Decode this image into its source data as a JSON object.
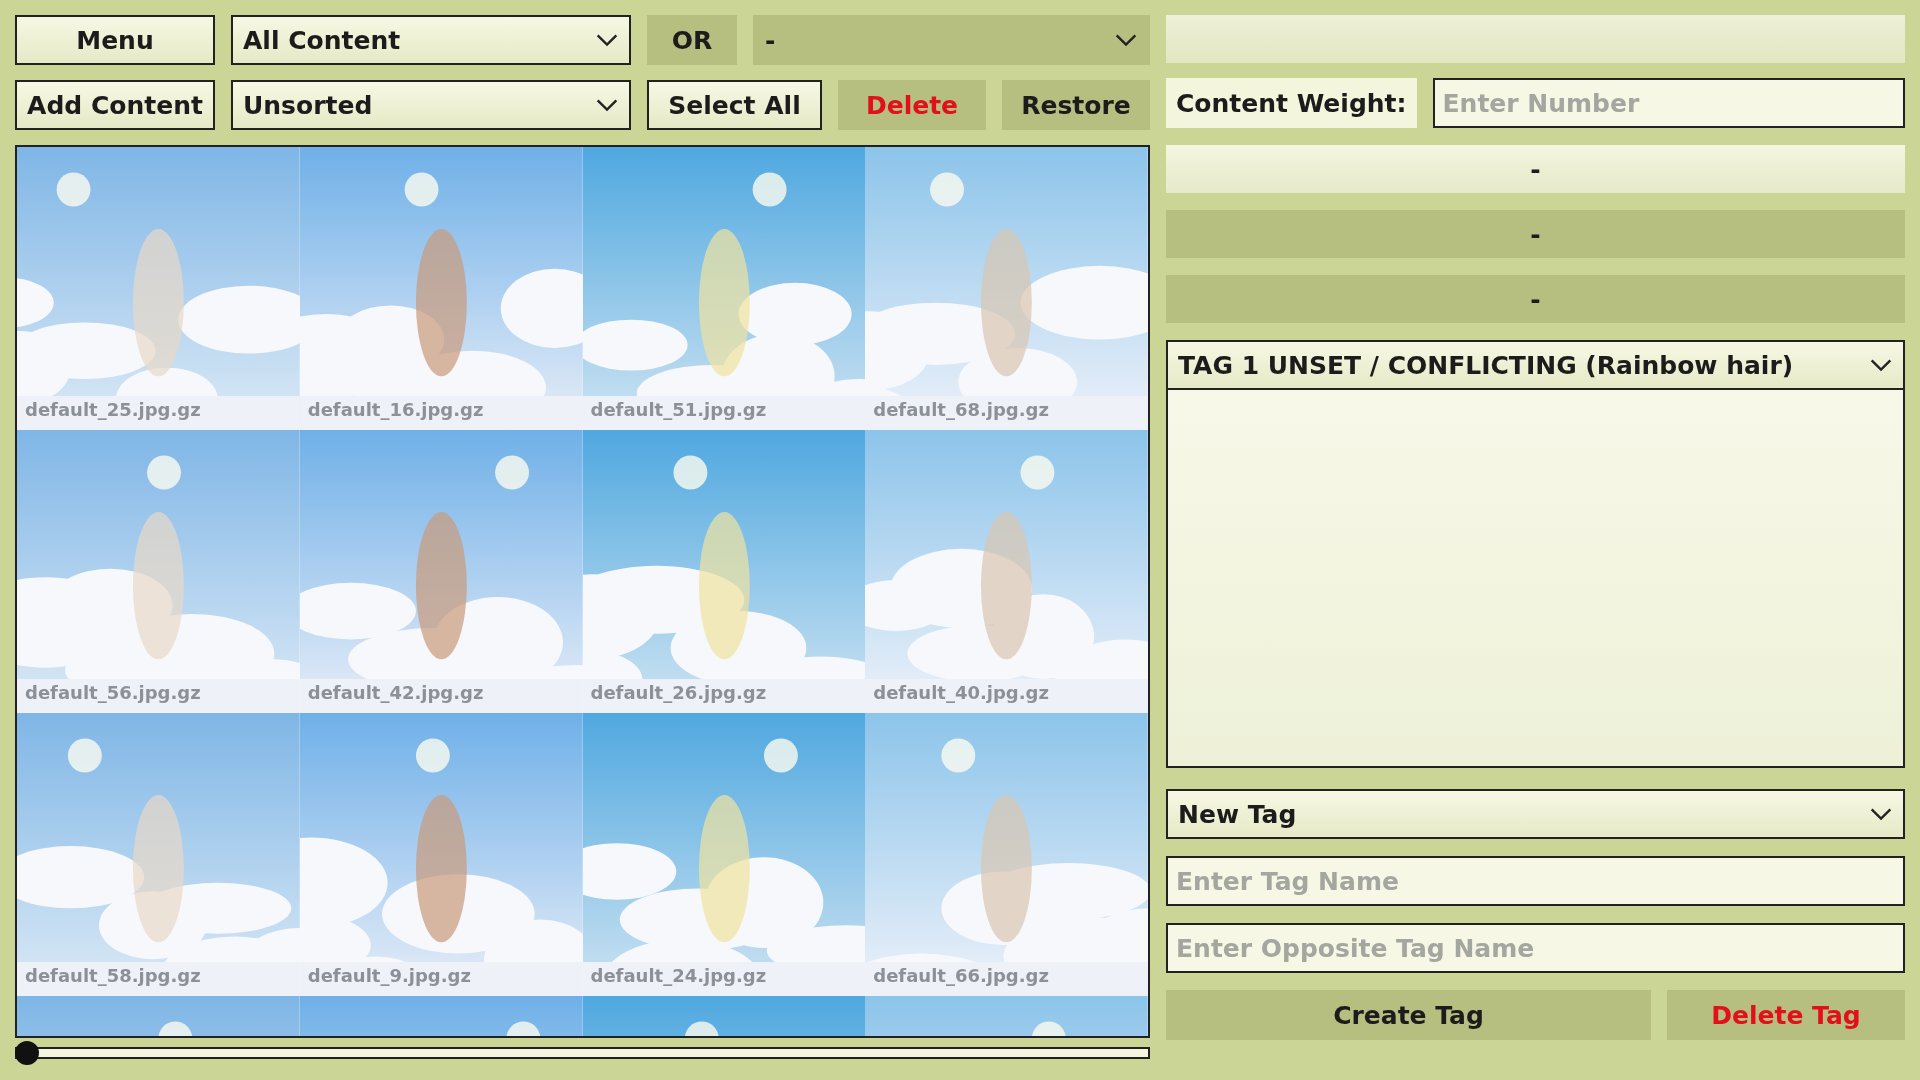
{
  "toolbar": {
    "menu_button": "Menu",
    "content_filter": {
      "value": "All Content"
    },
    "operator_button": "OR",
    "second_filter": {
      "value": "-"
    },
    "add_content_button": "Add Content",
    "sort_filter": {
      "value": "Unsorted"
    },
    "select_all_button": "Select All",
    "delete_button": "Delete",
    "restore_button": "Restore"
  },
  "gallery": {
    "tiles": [
      {
        "kind": "picture",
        "caption": "default_25.jpg.gz"
      },
      {
        "kind": "picture",
        "caption": "default_16.jpg.gz"
      },
      {
        "kind": "picture",
        "caption": "default_51.jpg.gz"
      },
      {
        "kind": "picture",
        "caption": "default_68.jpg.gz"
      },
      {
        "kind": "picture",
        "caption": "default_56.jpg.gz"
      },
      {
        "kind": "picture",
        "caption": "default_42.jpg.gz"
      },
      {
        "kind": "picture",
        "caption": "default_26.jpg.gz"
      },
      {
        "kind": "picture",
        "caption": "default_40.jpg.gz"
      },
      {
        "kind": "picture",
        "caption": "default_58.jpg.gz"
      },
      {
        "kind": "picture",
        "caption": "default_9.jpg.gz"
      },
      {
        "kind": "picture",
        "caption": "default_24.jpg.gz"
      },
      {
        "kind": "picture",
        "caption": "default_66.jpg.gz"
      },
      {
        "kind": "picture"
      },
      {
        "kind": "picture"
      },
      {
        "kind": "picture"
      },
      {
        "kind": "picture"
      }
    ]
  },
  "right_panel": {
    "weight": {
      "label": "Content Weight:",
      "placeholder": "Enter Number"
    },
    "slots": [
      {
        "label": "-",
        "selected": true
      },
      {
        "label": "-",
        "selected": false
      },
      {
        "label": "-",
        "selected": false
      }
    ],
    "tag_dropdown": {
      "value": "TAG 1 UNSET / CONFLICTING (Rainbow hair)"
    },
    "new_tag_dropdown": {
      "value": "New Tag"
    },
    "tag_name_field": {
      "placeholder": "Enter Tag Name"
    },
    "opposite_field": {
      "placeholder": "Enter Opposite Tag Name"
    },
    "create_button": "Create Tag",
    "delete_tag_button": "Delete Tag"
  }
}
